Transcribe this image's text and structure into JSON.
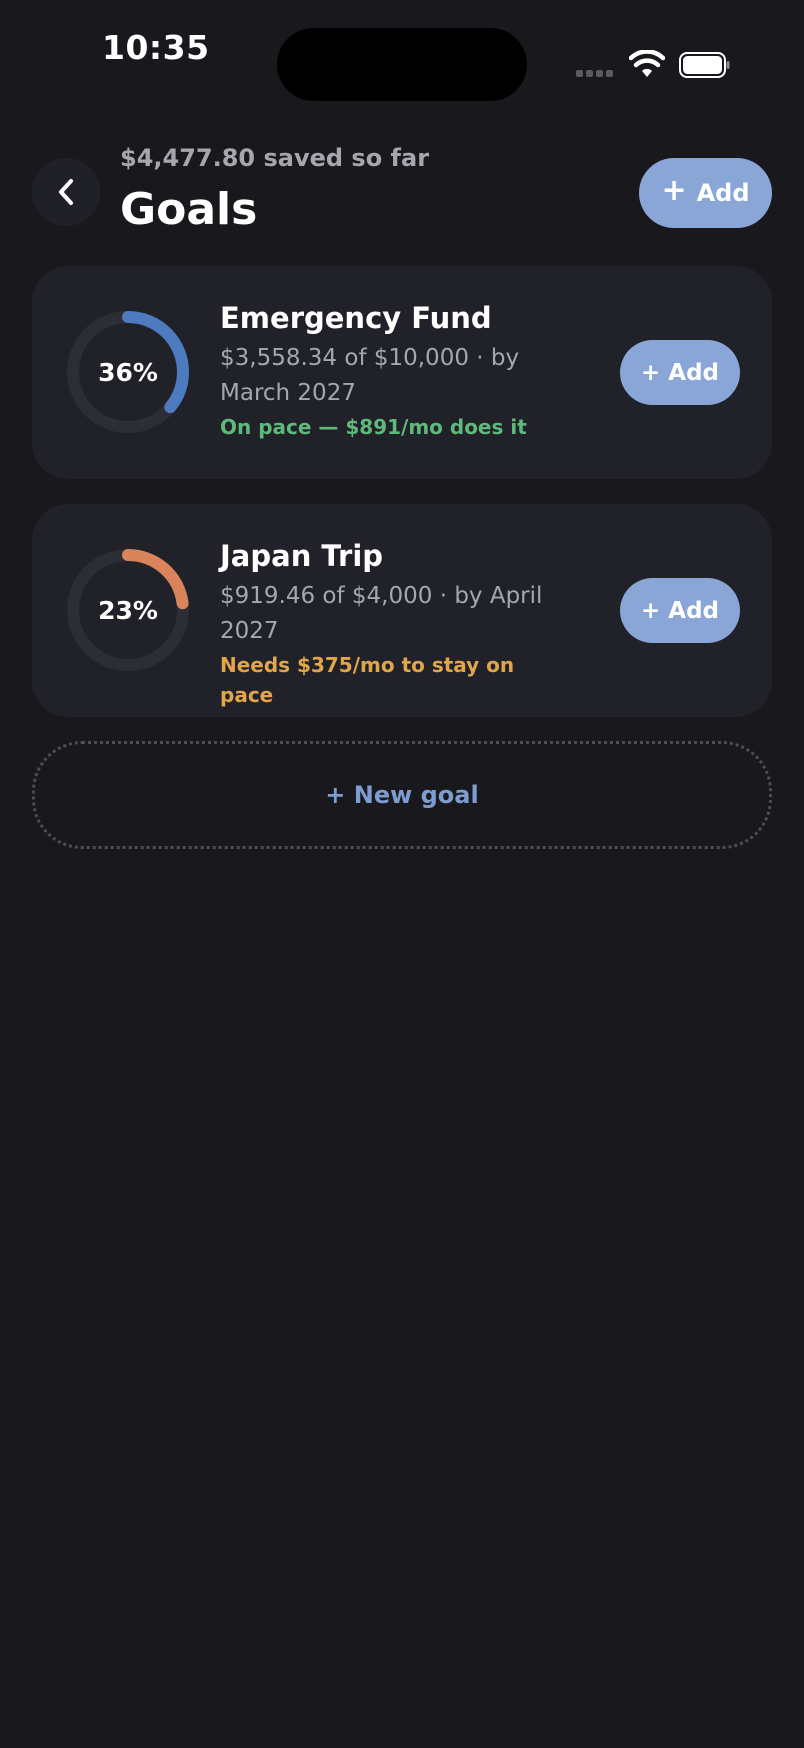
{
  "status_bar": {
    "time": "10:35"
  },
  "header": {
    "saved_summary": "$4,477.80 saved so far",
    "title": "Goals",
    "add_plus": "+",
    "add_label": "Add"
  },
  "goals": [
    {
      "name": "Emergency Fund",
      "percent_label": "36%",
      "progress": 0.36,
      "ring_color": "#4e7ac0",
      "amount_text": "$3,558.34 of $10,000 · by March 2027",
      "pace_text": "On pace — $891/mo does it",
      "pace_color": "#5fb97a",
      "add_label": "+ Add"
    },
    {
      "name": "Japan Trip",
      "percent_label": "23%",
      "progress": 0.23,
      "ring_color": "#d9845b",
      "amount_text": "$919.46 of $4,000 · by April 2027",
      "pace_text": "Needs $375/mo to stay on pace",
      "pace_color": "#e2a54a",
      "add_label": "+ Add"
    }
  ],
  "new_goal_label": "+ New goal",
  "colors": {
    "background": "#18181d",
    "card": "#212229",
    "accent": "#89a6d6",
    "muted_text": "#a6a7ae"
  }
}
